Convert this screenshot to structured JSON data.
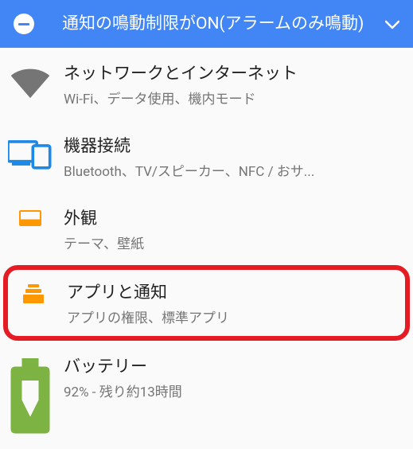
{
  "notification": {
    "text": "通知の鳴動制限がON(アラームのみ鳴動)"
  },
  "settings": {
    "network": {
      "title": "ネットワークとインターネット",
      "subtitle": "Wi-Fi、データ使用、機内モード"
    },
    "devices": {
      "title": "機器接続",
      "subtitle": "Bluetooth、TV/スピーカー、NFC / おサ..."
    },
    "display": {
      "title": "外観",
      "subtitle": "テーマ、壁紙"
    },
    "apps": {
      "title": "アプリと通知",
      "subtitle": "アプリの権限、標準アプリ"
    },
    "battery": {
      "title": "バッテリー",
      "subtitle": "92% - 残り約13時間"
    }
  }
}
